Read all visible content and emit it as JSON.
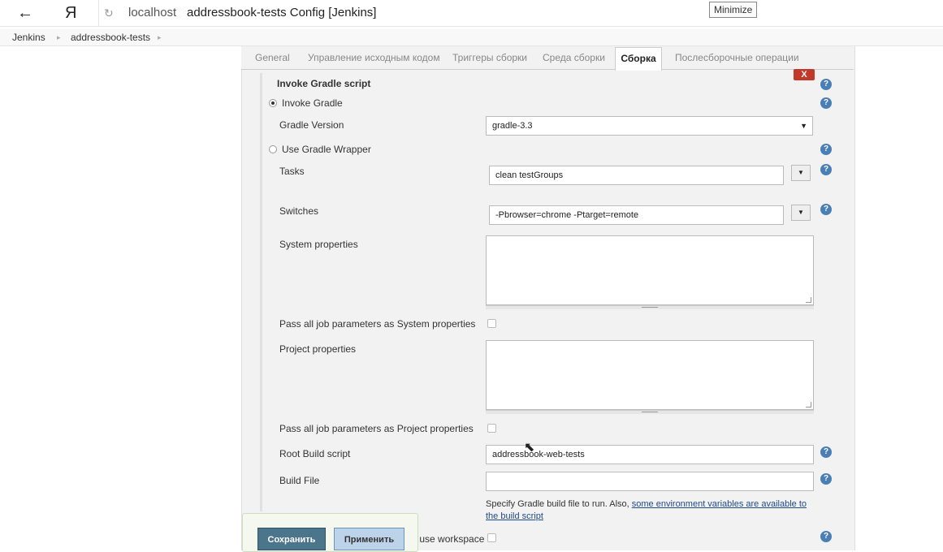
{
  "browser": {
    "back_icon": "←",
    "logo": "Я",
    "reload_icon": "↻",
    "url_host": "localhost",
    "title": "addressbook-tests Config [Jenkins]",
    "tooltip": "Minimize"
  },
  "breadcrumb": {
    "items": [
      "Jenkins",
      "addressbook-tests"
    ],
    "arrow": "▸"
  },
  "tabs": {
    "general": "General",
    "scm": "Управление исходным кодом",
    "triggers": "Триггеры сборки",
    "environment": "Среда сборки",
    "build": "Сборка",
    "post_build": "Послесборочные операции"
  },
  "step": {
    "title": "Invoke Gradle script",
    "delete_label": "X",
    "help_glyph": "?",
    "invoke_gradle_label": "Invoke Gradle",
    "gradle_version_label": "Gradle Version",
    "gradle_version_value": "gradle-3.3",
    "wrapper_label": "Use Gradle Wrapper",
    "tasks_label": "Tasks",
    "tasks_value": "clean testGroups",
    "switches_label": "Switches",
    "switches_value": "-Pbrowser=chrome -Ptarget=remote",
    "system_props_label": "System properties",
    "pass_system_label": "Pass all job parameters as System properties",
    "project_props_label": "Project properties",
    "pass_project_label": "Pass all job parameters as Project properties",
    "root_build_label": "Root Build script",
    "root_build_value": "addressbook-web-tests",
    "build_file_label": "Build File",
    "build_file_value": "",
    "hint_prefix": "Specify Gradle build file to run. Also, ",
    "hint_link": "some environment variables are available to the build script",
    "workspace_label": "to use workspace"
  },
  "actions": {
    "save": "Сохранить",
    "apply": "Применить"
  }
}
